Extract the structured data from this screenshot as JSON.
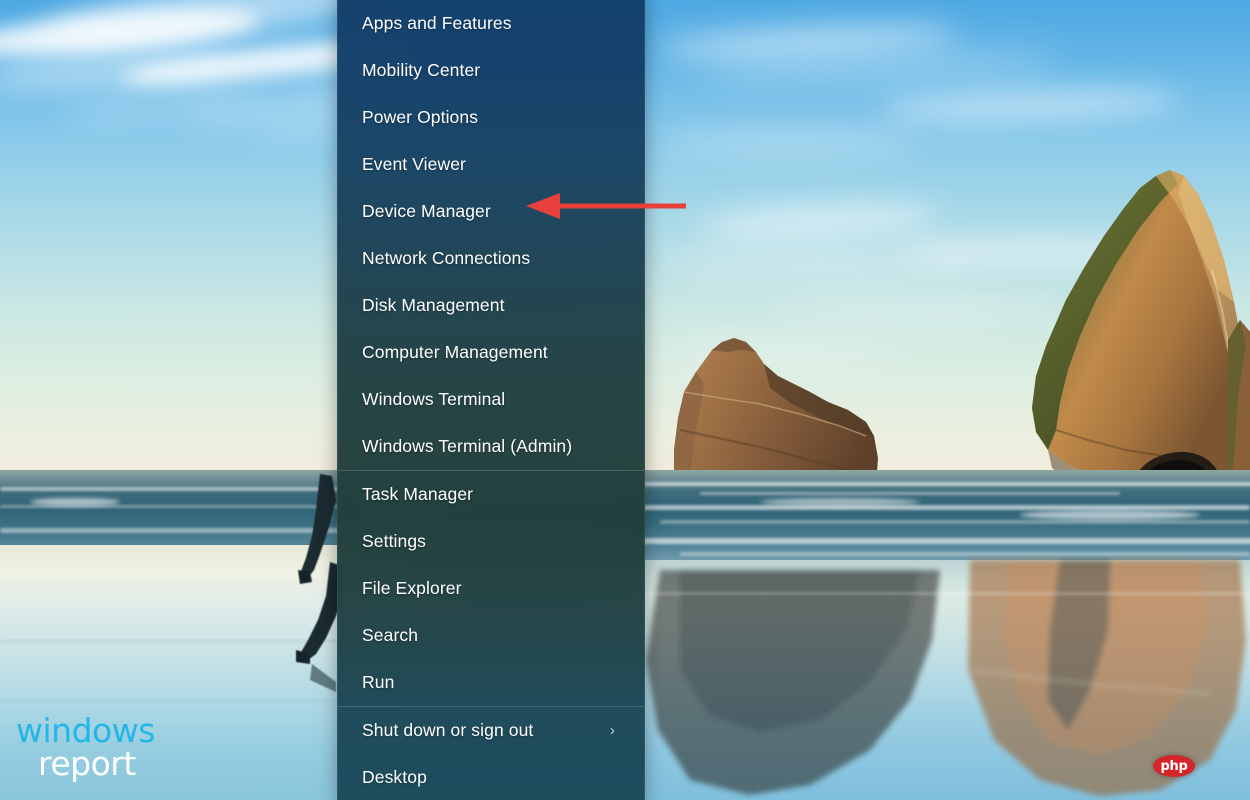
{
  "desktop": {
    "wallpaper_name": "wharariki-beach-archway-islands",
    "colors": {
      "sky_top": "#4ea8e2",
      "sky_bottom": "#efe6d4",
      "ocean": "#2f6276",
      "sand": "#cfe4e4",
      "rock_lit": "#c08a4a",
      "rock_shadow": "#6c4e33",
      "rock_moss": "#5f6b33"
    }
  },
  "power_menu": {
    "name": "Win+X Power User Menu",
    "background_gradient": [
      "#123e6a",
      "#1f3e42",
      "#1a495a"
    ],
    "sections": [
      {
        "id": "tools",
        "items": [
          {
            "label": "Apps and Features",
            "has_submenu": false
          },
          {
            "label": "Mobility Center",
            "has_submenu": false
          },
          {
            "label": "Power Options",
            "has_submenu": false
          },
          {
            "label": "Event Viewer",
            "has_submenu": false
          },
          {
            "label": "Device Manager",
            "has_submenu": false
          },
          {
            "label": "Network Connections",
            "has_submenu": false
          },
          {
            "label": "Disk Management",
            "has_submenu": false
          },
          {
            "label": "Computer Management",
            "has_submenu": false
          },
          {
            "label": "Windows Terminal",
            "has_submenu": false
          },
          {
            "label": "Windows Terminal (Admin)",
            "has_submenu": false
          }
        ]
      },
      {
        "id": "system",
        "items": [
          {
            "label": "Task Manager",
            "has_submenu": false
          },
          {
            "label": "Settings",
            "has_submenu": false
          },
          {
            "label": "File Explorer",
            "has_submenu": false
          },
          {
            "label": "Search",
            "has_submenu": false
          },
          {
            "label": "Run",
            "has_submenu": false
          }
        ]
      },
      {
        "id": "session",
        "items": [
          {
            "label": "Shut down or sign out",
            "has_submenu": true,
            "submenu_glyph": "›"
          },
          {
            "label": "Desktop",
            "has_submenu": false
          }
        ]
      }
    ]
  },
  "annotation": {
    "type": "arrow",
    "color": "#e8413c",
    "points_to": "Device Manager",
    "direction": "left"
  },
  "watermarks": {
    "windows_report": {
      "line1": "windows",
      "line2": "report",
      "line1_color": "#23b7e8",
      "line2_color": "#ffffff"
    },
    "php": {
      "label": "php",
      "background_color": "#d4262a",
      "text_color": "#ffffff"
    }
  }
}
